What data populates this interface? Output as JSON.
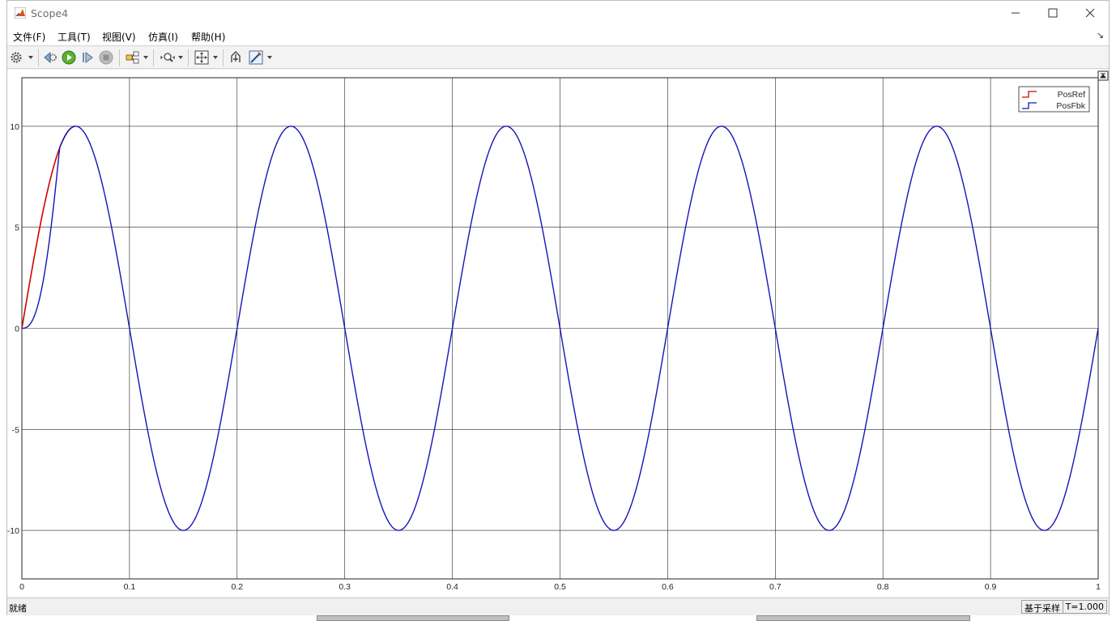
{
  "window": {
    "title": "Scope4"
  },
  "menu": [
    "文件(F)",
    "工具(T)",
    "视图(V)",
    "仿真(I)",
    "帮助(H)"
  ],
  "toolbar": {
    "icons": [
      "settings-icon",
      "step-back-icon",
      "run-icon",
      "step-forward-icon",
      "stop-icon",
      "highlight-block-icon",
      "zoom-icon",
      "autoscale-icon",
      "undock-icon",
      "style-icon"
    ]
  },
  "status": {
    "text": "就绪",
    "sample_mode": "基于采样",
    "time": "T=1.000"
  },
  "colors": {
    "posref": "#d40000",
    "posfbk": "#1515b5",
    "grid": "#262626"
  },
  "chart_data": {
    "type": "line",
    "title": "",
    "xlabel": "",
    "ylabel": "",
    "xlim": [
      0,
      1
    ],
    "ylim": [
      -12.4,
      12.4
    ],
    "xticks": [
      "0",
      "0.1",
      "0.2",
      "0.3",
      "0.4",
      "0.5",
      "0.6",
      "0.7",
      "0.8",
      "0.9",
      "1"
    ],
    "yticks": [
      "10",
      "5",
      "0",
      "-5",
      "-10"
    ],
    "ytick_values": [
      10,
      5,
      0,
      -5,
      -10
    ],
    "grid": true,
    "legend_position": "top-right",
    "series": [
      {
        "name": "PosRef",
        "color": "#d40000",
        "description": "10*sin(2*pi*5*t)",
        "x": [
          0,
          0.005,
          0.01,
          0.015,
          0.02,
          0.025,
          0.03,
          0.035,
          0.04,
          0.05
        ],
        "y": [
          0,
          1.56,
          3.09,
          4.54,
          5.88,
          7.07,
          8.09,
          8.91,
          9.51,
          10
        ]
      },
      {
        "name": "PosFbk",
        "color": "#1515b5",
        "description": "follows PosRef after a short initial lag",
        "x": [
          0,
          0.05,
          0.1,
          0.15,
          0.2,
          0.25,
          0.3,
          0.35,
          0.4,
          0.45,
          0.5,
          0.55,
          0.6,
          0.65,
          0.7,
          0.75,
          0.8,
          0.85,
          0.9,
          0.95,
          1.0
        ],
        "y": [
          0,
          10,
          0,
          -10,
          0,
          10,
          0,
          -10,
          0,
          10,
          0,
          -10,
          0,
          10,
          0,
          -10,
          0,
          10,
          0,
          -10,
          0
        ]
      }
    ]
  }
}
